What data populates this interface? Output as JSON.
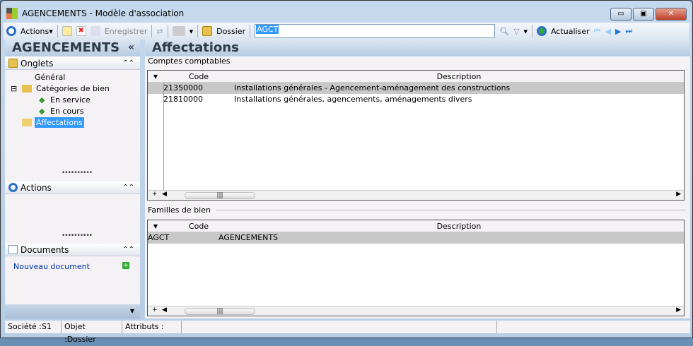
{
  "window": {
    "title": "AGENCEMENTS -  Modèle d'association",
    "minimize": "▭",
    "maximize": "▣",
    "close": "✕"
  },
  "toolbar": {
    "actions": "Actions",
    "save": "Enregistrer",
    "folder": "Dossier",
    "search_value": "AGCT",
    "refresh": "Actualiser"
  },
  "left": {
    "title": "AGENCEMENTS",
    "collapse": "«",
    "onglets": {
      "label": "Onglets",
      "items": [
        "Général",
        "Catégories de bien",
        "En service",
        "En cours",
        "Affectations"
      ]
    },
    "actions": {
      "label": "Actions"
    },
    "documents": {
      "label": "Documents",
      "new_doc": "Nouveau document"
    }
  },
  "main": {
    "title": "Affectations",
    "comptes": {
      "label": "Comptes comptables",
      "headers": [
        "Code",
        "Description"
      ],
      "rows": [
        [
          "21350000",
          "Installations générales - Agencement-aménagement des constructions"
        ],
        [
          "21810000",
          "Installations générales, agencements, aménagements divers"
        ]
      ]
    },
    "familles": {
      "label": "Familles de bien",
      "headers": [
        "Code",
        "Description"
      ],
      "rows": [
        [
          "AGCT",
          "AGENCEMENTS"
        ]
      ]
    }
  },
  "status": {
    "societe": "Société :S1",
    "objet": "Objet :Dossier",
    "attributs": "Attributs :"
  }
}
